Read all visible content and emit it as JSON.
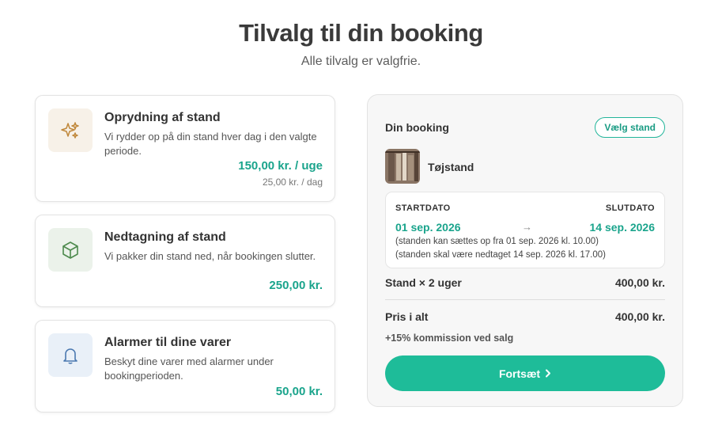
{
  "header": {
    "title": "Tilvalg til din booking",
    "subtitle": "Alle tilvalg er valgfrie."
  },
  "addons": [
    {
      "icon": "sparkles-icon",
      "title": "Oprydning af stand",
      "description": "Vi rydder op på din stand hver dag i den valgte periode.",
      "price": "150,00 kr. / uge",
      "sub_price": "25,00 kr. / dag"
    },
    {
      "icon": "box-icon",
      "title": "Nedtagning af stand",
      "description": "Vi pakker din stand ned, når bookingen slutter.",
      "price": "250,00 kr."
    },
    {
      "icon": "bell-icon",
      "title": "Alarmer til dine varer",
      "description": "Beskyt dine varer med alarmer under bookingperioden.",
      "price": "50,00 kr."
    }
  ],
  "booking": {
    "title": "Din booking",
    "pick_stand_label": "Vælg stand",
    "stand_name": "Tøjstand",
    "start_label": "STARTDATO",
    "end_label": "SLUTDATO",
    "start_date": "01 sep. 2026",
    "end_date": "14 sep. 2026",
    "arrow": "→",
    "note_start": "(standen kan sættes op fra 01 sep. 2026 kl. 10.00)",
    "note_end": "(standen skal være nedtaget 14 sep. 2026 kl. 17.00)",
    "line_label": "Stand × 2 uger",
    "line_value": "400,00 kr.",
    "total_label": "Pris i alt",
    "total_value": "400,00 kr.",
    "commission": "+15% kommission ved salg",
    "continue_label": "Fortsæt"
  },
  "colors": {
    "accent": "#1ebc99",
    "price_text": "#1aa48c",
    "icon_bg_cleanup": "#f7f1e8",
    "icon_bg_takedown": "#ebf2ea",
    "icon_bg_alarm": "#e9f0f8"
  }
}
